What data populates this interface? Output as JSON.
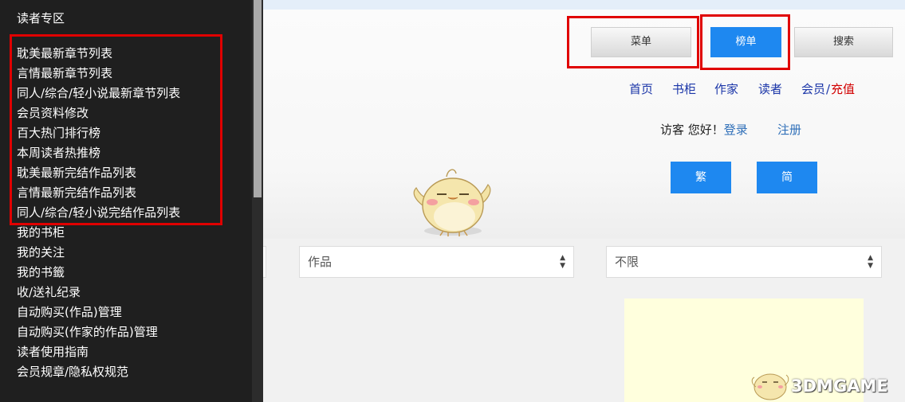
{
  "sidebar": {
    "title": "读者专区",
    "items": [
      "耽美最新章节列表",
      "言情最新章节列表",
      "同人/综合/轻小说最新章节列表",
      "会员资料修改",
      "百大热门排行榜",
      "本周读者热推榜",
      "耽美最新完结作品列表",
      "言情最新完结作品列表",
      "同人/综合/轻小说完结作品列表",
      "我的书柜",
      "我的关注",
      "我的书籤",
      "收/送礼纪录",
      "自动购买(作品)管理",
      "自动购买(作家的作品)管理",
      "读者使用指南",
      "会员规章/隐私权规范"
    ]
  },
  "header": {
    "menu_button": "菜单",
    "rank_button": "榜单",
    "search_button": "搜索",
    "nav": {
      "home": "首页",
      "bookshelf": "书柜",
      "author": "作家",
      "reader": "读者",
      "member": "会员",
      "slash": "/",
      "recharge": "充值"
    },
    "greeting": {
      "text": "访客 您好！",
      "login": "登录",
      "register": "注册"
    },
    "traditional_button": "繁",
    "simplified_button": "简"
  },
  "filters": {
    "type_select": {
      "value": "作品"
    },
    "range_select": {
      "value": "不限"
    }
  },
  "watermark": {
    "text": "3DMGAME"
  },
  "colors": {
    "sidebar_bg": "#1f1f1f",
    "accent_blue": "#1e88f0",
    "nav_link": "#1a35a8",
    "highlight_red": "#e00000",
    "recharge_red": "#d20000"
  }
}
